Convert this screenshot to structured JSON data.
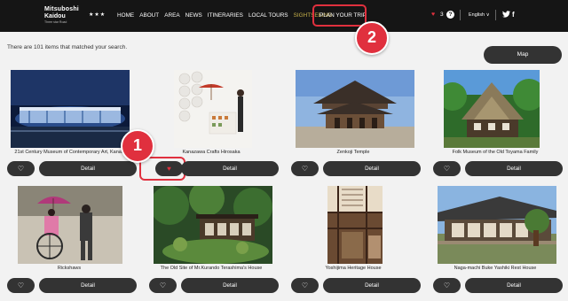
{
  "header": {
    "logo_line1": "Mitsuboshi",
    "logo_line2": "Kaidou",
    "logo_tagline": "Three star Road",
    "stars": "★★★",
    "menu": [
      "HOME",
      "ABOUT",
      "AREA",
      "NEWS",
      "ITINERARIES",
      "LOCAL TOURS",
      "SIGHTSEEING"
    ],
    "plan_label": "PLAN YOUR TRIP",
    "favorites_count": "3",
    "help": "?",
    "language": "English ∨"
  },
  "annotations": [
    "1",
    "2"
  ],
  "results_text": "There are 101 items that matched your search.",
  "map_label": "Map",
  "detail_label": "Detail",
  "heart_glyph": "♡",
  "heart_glyph_on": "♥",
  "places": [
    {
      "name": "21st Century Museum of Contemporary Art, Kanaz",
      "favorited": false
    },
    {
      "name": "Kanazawa Crafts Hirosaka",
      "favorited": true
    },
    {
      "name": "Zenkoji Temple",
      "favorited": false
    },
    {
      "name": "Folk Museum of the Old Toyama Family",
      "favorited": false
    },
    {
      "name": "Rickshaws",
      "favorited": false
    },
    {
      "name": "The Old Site of Mr.Kurando Terashima's House",
      "favorited": false
    },
    {
      "name": "Yoshijima Heritage House",
      "favorited": false
    },
    {
      "name": "Naga-machi Buke Yashiki Rest House",
      "favorited": false
    }
  ],
  "colors": {
    "nav_bg": "#151515",
    "accent_red": "#e0303e",
    "active_menu": "#c8b24a",
    "button_dark": "#333333"
  }
}
